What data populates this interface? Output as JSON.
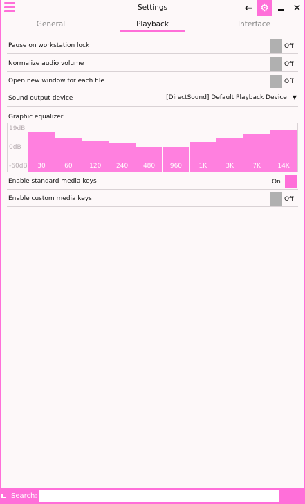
{
  "window": {
    "title": "Settings"
  },
  "icons": {
    "menu": "hamburger-icon",
    "back": "back-arrow-icon",
    "settings": "gear-icon",
    "minimize": "minimize-icon",
    "close": "close-icon",
    "back_glyph": "←",
    "gear_glyph": "⚙",
    "close_glyph": "✕"
  },
  "tabs": [
    {
      "label": "General",
      "active": false
    },
    {
      "label": "Playback",
      "active": true
    },
    {
      "label": "Interface",
      "active": false
    }
  ],
  "settings": {
    "pause_lock": {
      "label": "Pause on workstation lock",
      "state": "Off"
    },
    "normalize": {
      "label": "Normalize audio volume",
      "state": "Off"
    },
    "new_window": {
      "label": "Open new window for each file",
      "state": "Off"
    },
    "output_device": {
      "label": "Sound output device",
      "value": "[DirectSound] Default Playback Device",
      "arrow": "▼"
    },
    "std_media_keys": {
      "label": "Enable standard media keys",
      "state": "On"
    },
    "custom_media_keys": {
      "label": "Enable custom media keys",
      "state": "Off"
    }
  },
  "equalizer": {
    "label": "Graphic equalizer",
    "scale": {
      "top": "19dB",
      "mid": "0dB",
      "bottom": "-60dB"
    },
    "bands": [
      {
        "label": "30",
        "level": 0.83
      },
      {
        "label": "60",
        "level": 0.69
      },
      {
        "label": "120",
        "level": 0.63
      },
      {
        "label": "240",
        "level": 0.58
      },
      {
        "label": "480",
        "level": 0.5
      },
      {
        "label": "960",
        "level": 0.5
      },
      {
        "label": "1K",
        "level": 0.62
      },
      {
        "label": "3K",
        "level": 0.7
      },
      {
        "label": "7K",
        "level": 0.77
      },
      {
        "label": "14K",
        "level": 0.86
      }
    ]
  },
  "search": {
    "label": "Search:",
    "value": "",
    "placeholder": ""
  },
  "colors": {
    "accent": "#ff6fd9",
    "band": "#ff80df",
    "toggle_off": "#b0b0b0",
    "background": "#fdf8f9"
  }
}
